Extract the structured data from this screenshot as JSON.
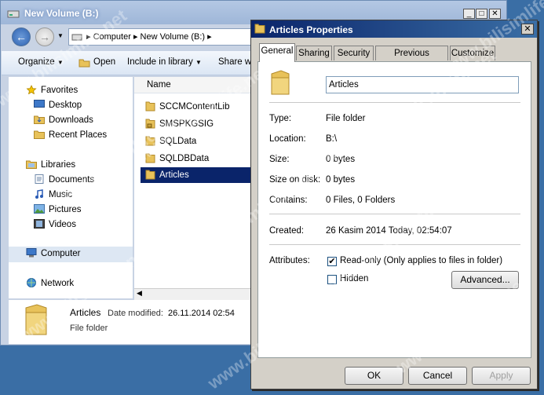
{
  "explorer": {
    "title": "New Volume (B:)",
    "address": {
      "segments": [
        "Computer",
        "New Volume (B:)"
      ]
    },
    "toolbar": {
      "organize": "Organize",
      "open": "Open",
      "include": "Include in library",
      "share": "Share wi"
    },
    "nav": {
      "favorites": "Favorites",
      "desktop": "Desktop",
      "downloads": "Downloads",
      "recent": "Recent Places",
      "libraries": "Libraries",
      "documents": "Documents",
      "music": "Music",
      "pictures": "Pictures",
      "videos": "Videos",
      "computer": "Computer",
      "network": "Network"
    },
    "column_name": "Name",
    "files": [
      "SCCMContentLib",
      "SMSPKGSIG",
      "SQLData",
      "SQLDBData",
      "Articles"
    ],
    "details": {
      "name": "Articles",
      "modified_label": "Date modified:",
      "modified_value": "26.11.2014 02:54",
      "type": "File folder"
    }
  },
  "dialog": {
    "title": "Articles Properties",
    "tabs": [
      "General",
      "Sharing",
      "Security",
      "Previous Versions",
      "Customize"
    ],
    "name": "Articles",
    "props": {
      "type_label": "Type:",
      "type_value": "File folder",
      "location_label": "Location:",
      "location_value": "B:\\",
      "size_label": "Size:",
      "size_value": "0 bytes",
      "size_disk_label": "Size on disk:",
      "size_disk_value": "0 bytes",
      "contains_label": "Contains:",
      "contains_value": "0 Files, 0 Folders",
      "created_label": "Created:",
      "created_value": "26 Kasim 2014 Today, 02:54:07",
      "attributes_label": "Attributes:",
      "readonly_label": "Read-only (Only applies to files in folder)",
      "hidden_label": "Hidden",
      "advanced_label": "Advanced..."
    },
    "buttons": {
      "ok": "OK",
      "cancel": "Cancel",
      "apply": "Apply"
    }
  },
  "watermark": "www.bilisimlife.net",
  "colors": {
    "selection": "#0a246a",
    "folder": "#e8c25a",
    "dialog_bg": "#d4d0c8"
  }
}
